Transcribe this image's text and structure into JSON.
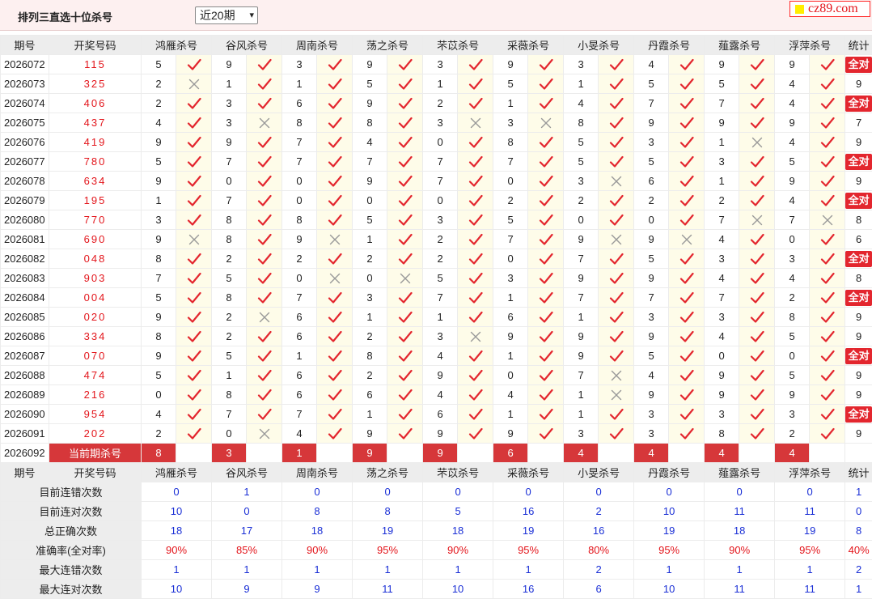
{
  "header": {
    "title": "排列三直选十位杀号",
    "period_select": "近20期",
    "logo_text": "cz89.com"
  },
  "colors": {
    "red": "#e3151b",
    "blue": "#1a2fd6",
    "badge": "#e3262e",
    "mark_bg": "#fefce9"
  },
  "columns": {
    "issue": "期号",
    "draw": "开奖号码",
    "experts": [
      "鸿雁杀号",
      "谷风杀号",
      "周南杀号",
      "荡之杀号",
      "芣苡杀号",
      "采薇杀号",
      "小旻杀号",
      "丹霞杀号",
      "薤露杀号",
      "浮萍杀号"
    ],
    "total": "统计"
  },
  "all_correct_label": "全对",
  "rows": [
    {
      "issue": "2026072",
      "draw": "115",
      "kills": [
        [
          5,
          1
        ],
        [
          9,
          1
        ],
        [
          3,
          1
        ],
        [
          9,
          1
        ],
        [
          3,
          1
        ],
        [
          9,
          1
        ],
        [
          3,
          1
        ],
        [
          4,
          1
        ],
        [
          9,
          1
        ],
        [
          9,
          1
        ]
      ],
      "total": "全对"
    },
    {
      "issue": "2026073",
      "draw": "325",
      "kills": [
        [
          2,
          0
        ],
        [
          1,
          1
        ],
        [
          1,
          1
        ],
        [
          5,
          1
        ],
        [
          1,
          1
        ],
        [
          5,
          1
        ],
        [
          1,
          1
        ],
        [
          5,
          1
        ],
        [
          5,
          1
        ],
        [
          4,
          1
        ]
      ],
      "total": "9"
    },
    {
      "issue": "2026074",
      "draw": "406",
      "kills": [
        [
          2,
          1
        ],
        [
          3,
          1
        ],
        [
          6,
          1
        ],
        [
          9,
          1
        ],
        [
          2,
          1
        ],
        [
          1,
          1
        ],
        [
          4,
          1
        ],
        [
          7,
          1
        ],
        [
          7,
          1
        ],
        [
          4,
          1
        ]
      ],
      "total": "全对"
    },
    {
      "issue": "2026075",
      "draw": "437",
      "kills": [
        [
          4,
          1
        ],
        [
          3,
          0
        ],
        [
          8,
          1
        ],
        [
          8,
          1
        ],
        [
          3,
          0
        ],
        [
          3,
          0
        ],
        [
          8,
          1
        ],
        [
          9,
          1
        ],
        [
          9,
          1
        ],
        [
          9,
          1
        ]
      ],
      "total": "7"
    },
    {
      "issue": "2026076",
      "draw": "419",
      "kills": [
        [
          9,
          1
        ],
        [
          9,
          1
        ],
        [
          7,
          1
        ],
        [
          4,
          1
        ],
        [
          0,
          1
        ],
        [
          8,
          1
        ],
        [
          5,
          1
        ],
        [
          3,
          1
        ],
        [
          1,
          0
        ],
        [
          4,
          1
        ]
      ],
      "total": "9"
    },
    {
      "issue": "2026077",
      "draw": "780",
      "kills": [
        [
          5,
          1
        ],
        [
          7,
          1
        ],
        [
          7,
          1
        ],
        [
          7,
          1
        ],
        [
          7,
          1
        ],
        [
          7,
          1
        ],
        [
          5,
          1
        ],
        [
          5,
          1
        ],
        [
          3,
          1
        ],
        [
          5,
          1
        ]
      ],
      "total": "全对"
    },
    {
      "issue": "2026078",
      "draw": "634",
      "kills": [
        [
          9,
          1
        ],
        [
          0,
          1
        ],
        [
          0,
          1
        ],
        [
          9,
          1
        ],
        [
          7,
          1
        ],
        [
          0,
          1
        ],
        [
          3,
          0
        ],
        [
          6,
          1
        ],
        [
          1,
          1
        ],
        [
          9,
          1
        ]
      ],
      "total": "9"
    },
    {
      "issue": "2026079",
      "draw": "195",
      "kills": [
        [
          1,
          1
        ],
        [
          7,
          1
        ],
        [
          0,
          1
        ],
        [
          0,
          1
        ],
        [
          0,
          1
        ],
        [
          2,
          1
        ],
        [
          2,
          1
        ],
        [
          2,
          1
        ],
        [
          2,
          1
        ],
        [
          4,
          1
        ]
      ],
      "total": "全对"
    },
    {
      "issue": "2026080",
      "draw": "770",
      "kills": [
        [
          3,
          1
        ],
        [
          8,
          1
        ],
        [
          8,
          1
        ],
        [
          5,
          1
        ],
        [
          3,
          1
        ],
        [
          5,
          1
        ],
        [
          0,
          1
        ],
        [
          0,
          1
        ],
        [
          7,
          0
        ],
        [
          7,
          0
        ]
      ],
      "total": "8"
    },
    {
      "issue": "2026081",
      "draw": "690",
      "kills": [
        [
          9,
          0
        ],
        [
          8,
          1
        ],
        [
          9,
          0
        ],
        [
          1,
          1
        ],
        [
          2,
          1
        ],
        [
          7,
          1
        ],
        [
          9,
          0
        ],
        [
          9,
          0
        ],
        [
          4,
          1
        ],
        [
          0,
          1
        ]
      ],
      "total": "6"
    },
    {
      "issue": "2026082",
      "draw": "048",
      "kills": [
        [
          8,
          1
        ],
        [
          2,
          1
        ],
        [
          2,
          1
        ],
        [
          2,
          1
        ],
        [
          2,
          1
        ],
        [
          0,
          1
        ],
        [
          7,
          1
        ],
        [
          5,
          1
        ],
        [
          3,
          1
        ],
        [
          3,
          1
        ]
      ],
      "total": "全对"
    },
    {
      "issue": "2026083",
      "draw": "903",
      "kills": [
        [
          7,
          1
        ],
        [
          5,
          1
        ],
        [
          0,
          0
        ],
        [
          0,
          0
        ],
        [
          5,
          1
        ],
        [
          3,
          1
        ],
        [
          9,
          1
        ],
        [
          9,
          1
        ],
        [
          4,
          1
        ],
        [
          4,
          1
        ]
      ],
      "total": "8"
    },
    {
      "issue": "2026084",
      "draw": "004",
      "kills": [
        [
          5,
          1
        ],
        [
          8,
          1
        ],
        [
          7,
          1
        ],
        [
          3,
          1
        ],
        [
          7,
          1
        ],
        [
          1,
          1
        ],
        [
          7,
          1
        ],
        [
          7,
          1
        ],
        [
          7,
          1
        ],
        [
          2,
          1
        ]
      ],
      "total": "全对"
    },
    {
      "issue": "2026085",
      "draw": "020",
      "kills": [
        [
          9,
          1
        ],
        [
          2,
          0
        ],
        [
          6,
          1
        ],
        [
          1,
          1
        ],
        [
          1,
          1
        ],
        [
          6,
          1
        ],
        [
          1,
          1
        ],
        [
          3,
          1
        ],
        [
          3,
          1
        ],
        [
          8,
          1
        ]
      ],
      "total": "9"
    },
    {
      "issue": "2026086",
      "draw": "334",
      "kills": [
        [
          8,
          1
        ],
        [
          2,
          1
        ],
        [
          6,
          1
        ],
        [
          2,
          1
        ],
        [
          3,
          0
        ],
        [
          9,
          1
        ],
        [
          9,
          1
        ],
        [
          9,
          1
        ],
        [
          4,
          1
        ],
        [
          5,
          1
        ]
      ],
      "total": "9"
    },
    {
      "issue": "2026087",
      "draw": "070",
      "kills": [
        [
          9,
          1
        ],
        [
          5,
          1
        ],
        [
          1,
          1
        ],
        [
          8,
          1
        ],
        [
          4,
          1
        ],
        [
          1,
          1
        ],
        [
          9,
          1
        ],
        [
          5,
          1
        ],
        [
          0,
          1
        ],
        [
          0,
          1
        ]
      ],
      "total": "全对"
    },
    {
      "issue": "2026088",
      "draw": "474",
      "kills": [
        [
          5,
          1
        ],
        [
          1,
          1
        ],
        [
          6,
          1
        ],
        [
          2,
          1
        ],
        [
          9,
          1
        ],
        [
          0,
          1
        ],
        [
          7,
          0
        ],
        [
          4,
          1
        ],
        [
          9,
          1
        ],
        [
          5,
          1
        ]
      ],
      "total": "9"
    },
    {
      "issue": "2026089",
      "draw": "216",
      "kills": [
        [
          0,
          1
        ],
        [
          8,
          1
        ],
        [
          6,
          1
        ],
        [
          6,
          1
        ],
        [
          4,
          1
        ],
        [
          4,
          1
        ],
        [
          1,
          0
        ],
        [
          9,
          1
        ],
        [
          9,
          1
        ],
        [
          9,
          1
        ]
      ],
      "total": "9"
    },
    {
      "issue": "2026090",
      "draw": "954",
      "kills": [
        [
          4,
          1
        ],
        [
          7,
          1
        ],
        [
          7,
          1
        ],
        [
          1,
          1
        ],
        [
          6,
          1
        ],
        [
          1,
          1
        ],
        [
          1,
          1
        ],
        [
          3,
          1
        ],
        [
          3,
          1
        ],
        [
          3,
          1
        ]
      ],
      "total": "全对"
    },
    {
      "issue": "2026091",
      "draw": "202",
      "kills": [
        [
          2,
          1
        ],
        [
          0,
          0
        ],
        [
          4,
          1
        ],
        [
          9,
          1
        ],
        [
          9,
          1
        ],
        [
          9,
          1
        ],
        [
          3,
          1
        ],
        [
          3,
          1
        ],
        [
          8,
          1
        ],
        [
          2,
          1
        ]
      ],
      "total": "9"
    }
  ],
  "current": {
    "issue": "2026092",
    "label": "当前期杀号",
    "kills": [
      "8",
      "3",
      "1",
      "9",
      "9",
      "6",
      "4",
      "4",
      "4",
      "4"
    ]
  },
  "stats": [
    {
      "label": "目前连错次数",
      "values": [
        "0",
        "1",
        "0",
        "0",
        "0",
        "0",
        "0",
        "0",
        "0",
        "0"
      ],
      "total": "1"
    },
    {
      "label": "目前连对次数",
      "values": [
        "10",
        "0",
        "8",
        "8",
        "5",
        "16",
        "2",
        "10",
        "11",
        "11"
      ],
      "total": "0"
    },
    {
      "label": "总正确次数",
      "values": [
        "18",
        "17",
        "18",
        "19",
        "18",
        "19",
        "16",
        "19",
        "18",
        "19"
      ],
      "total": "8"
    },
    {
      "label": "准确率(全对率)",
      "values": [
        "90%",
        "85%",
        "90%",
        "95%",
        "90%",
        "95%",
        "80%",
        "95%",
        "90%",
        "95%"
      ],
      "total": "40%",
      "red": true
    },
    {
      "label": "最大连错次数",
      "values": [
        "1",
        "1",
        "1",
        "1",
        "1",
        "1",
        "2",
        "1",
        "1",
        "1"
      ],
      "total": "2"
    },
    {
      "label": "最大连对次数",
      "values": [
        "10",
        "9",
        "9",
        "11",
        "10",
        "16",
        "6",
        "10",
        "11",
        "11"
      ],
      "total": "1"
    }
  ]
}
